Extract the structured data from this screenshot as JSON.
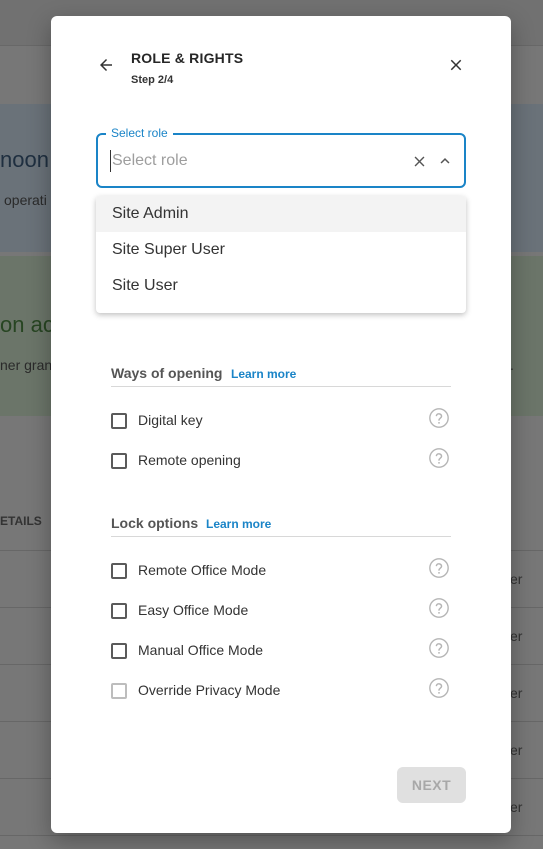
{
  "background": {
    "blue_title": "noon",
    "blue_subtitle": "operati",
    "green_title": "on ac",
    "green_subtitle": "ner grant",
    "green_trailing": ".",
    "table_header": "ETAILS",
    "row_suffixes": [
      "er",
      "er",
      "er",
      "er",
      "er"
    ]
  },
  "dialog": {
    "title": "ROLE & RIGHTS",
    "step": "Step 2/4",
    "select": {
      "label": "Select role",
      "placeholder": "Select role",
      "value": "",
      "options": [
        "Site Admin",
        "Site Super User",
        "Site User"
      ],
      "highlighted_index": 0
    },
    "ways_of_opening": {
      "title": "Ways of opening",
      "learn_more": "Learn more",
      "items": [
        {
          "label": "Digital key",
          "checked": false,
          "disabled": false
        },
        {
          "label": "Remote opening",
          "checked": false,
          "disabled": false
        }
      ]
    },
    "lock_options": {
      "title": "Lock options",
      "learn_more": "Learn more",
      "items": [
        {
          "label": "Remote Office Mode",
          "checked": false,
          "disabled": false
        },
        {
          "label": "Easy Office Mode",
          "checked": false,
          "disabled": false
        },
        {
          "label": "Manual Office Mode",
          "checked": false,
          "disabled": false
        },
        {
          "label": "Override Privacy Mode",
          "checked": false,
          "disabled": true
        }
      ]
    },
    "next_label": "NEXT",
    "next_disabled": true
  },
  "colors": {
    "accent": "#1a84c7",
    "text": "#333333",
    "disabled_bg": "#e0e0e0"
  },
  "icons": [
    "arrow-left-icon",
    "close-icon",
    "clear-icon",
    "chevron-up-icon",
    "help-circle-icon"
  ]
}
